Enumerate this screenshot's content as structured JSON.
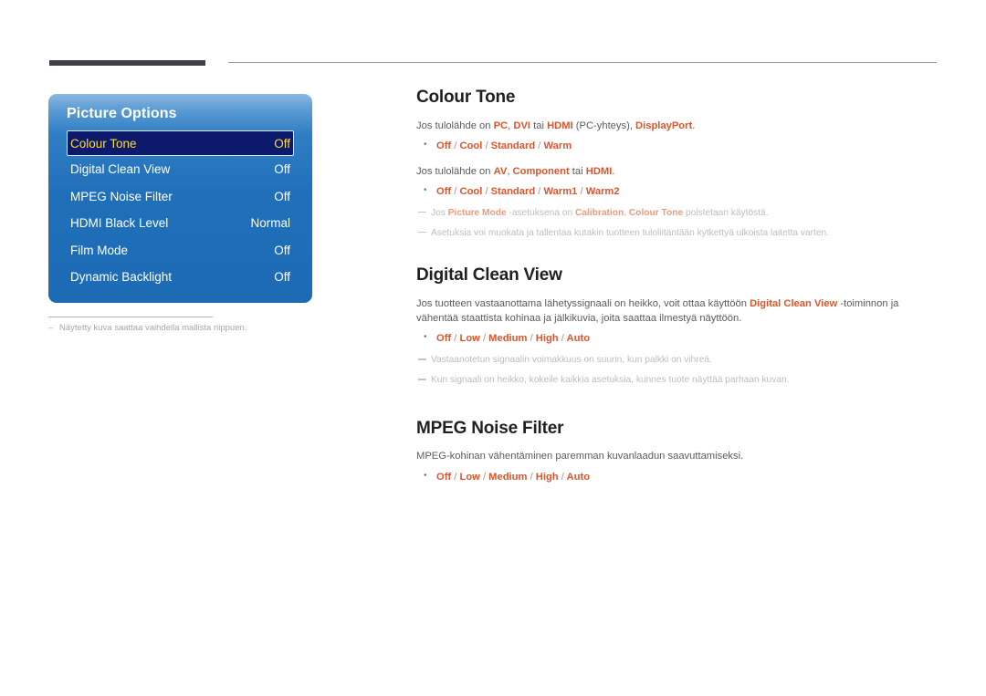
{
  "page": {
    "language": "fi",
    "accent_color": "#e0532a",
    "heading_color": "#231f20",
    "note_color": "#bdbbc0"
  },
  "osd": {
    "title": "Picture Options",
    "rows": [
      {
        "label": "Colour Tone",
        "value": "Off",
        "selected": true
      },
      {
        "label": "Digital Clean View",
        "value": "Off",
        "selected": false
      },
      {
        "label": "MPEG Noise Filter",
        "value": "Off",
        "selected": false
      },
      {
        "label": "HDMI Black Level",
        "value": "Normal",
        "selected": false
      },
      {
        "label": "Film Mode",
        "value": "Off",
        "selected": false
      },
      {
        "label": "Dynamic Backlight",
        "value": "Off",
        "selected": false
      }
    ],
    "caption_dash": "–",
    "caption": "Näytetty kuva saattaa vaihdella mallista riippuen."
  },
  "sections": {
    "colour_tone": {
      "title": "Colour Tone",
      "body1_parts": [
        {
          "t": "Jos tulolähde on ",
          "hl": false
        },
        {
          "t": "PC",
          "hl": true
        },
        {
          "t": ", ",
          "hl": false
        },
        {
          "t": "DVI",
          "hl": true
        },
        {
          "t": " tai ",
          "hl": false
        },
        {
          "t": "HDMI",
          "hl": true
        },
        {
          "t": " (PC-yhteys), ",
          "hl": false
        },
        {
          "t": "DisplayPort",
          "hl": true
        },
        {
          "t": ".",
          "hl": false
        }
      ],
      "bullet1": "Off / Cool / Standard / Warm",
      "body2_parts": [
        {
          "t": "Jos tulolähde on ",
          "hl": false
        },
        {
          "t": "AV",
          "hl": true
        },
        {
          "t": ", ",
          "hl": false
        },
        {
          "t": "Component",
          "hl": true
        },
        {
          "t": " tai ",
          "hl": false
        },
        {
          "t": "HDMI",
          "hl": true
        },
        {
          "t": ".",
          "hl": false
        }
      ],
      "bullet2": "Off / Cool / Standard / Warm1 / Warm2",
      "note1_parts": [
        {
          "t": "Jos ",
          "hl": false
        },
        {
          "t": "Picture Mode",
          "hl": true
        },
        {
          "t": " -asetuksena on ",
          "hl": false
        },
        {
          "t": "Calibration",
          "hl": true
        },
        {
          "t": ", ",
          "hl": false
        },
        {
          "t": "Colour Tone",
          "hl": true
        },
        {
          "t": " poistetaan käytöstä.",
          "hl": false
        }
      ],
      "note2_parts": [
        {
          "t": "Asetuksia voi muokata ja tallentaa kutakin tuotteen tuloliitäntään kytkettyä ulkoista laitetta varten.",
          "hl": false
        }
      ]
    },
    "digital_clean_view": {
      "title": "Digital Clean View",
      "body1_parts": [
        {
          "t": "Jos tuotteen vastaanottama lähetyssignaali on heikko, voit ottaa käyttöön ",
          "hl": false
        },
        {
          "t": "Digital Clean View",
          "hl": true
        },
        {
          "t": " -toiminnon ja vähentää staattista kohinaa ja jälkikuvia, joita saattaa ilmestyä näyttöön.",
          "hl": false
        }
      ],
      "bullet1": "Off / Low / Medium / High / Auto",
      "note1_parts": [
        {
          "t": "Vastaanotetun signaalin voimakkuus on suurin, kun palkki on vihreä.",
          "hl": false
        }
      ],
      "note2_parts": [
        {
          "t": "Kun signaali on heikko, kokeile kaikkia asetuksia, kunnes tuote näyttää parhaan kuvan.",
          "hl": false
        }
      ]
    },
    "mpeg_noise_filter": {
      "title": "MPEG Noise Filter",
      "body1_parts": [
        {
          "t": "MPEG-kohinan vähentäminen paremman kuvanlaadun saavuttamiseksi.",
          "hl": false
        }
      ],
      "bullet1": "Off / Low / Medium / High / Auto"
    }
  }
}
